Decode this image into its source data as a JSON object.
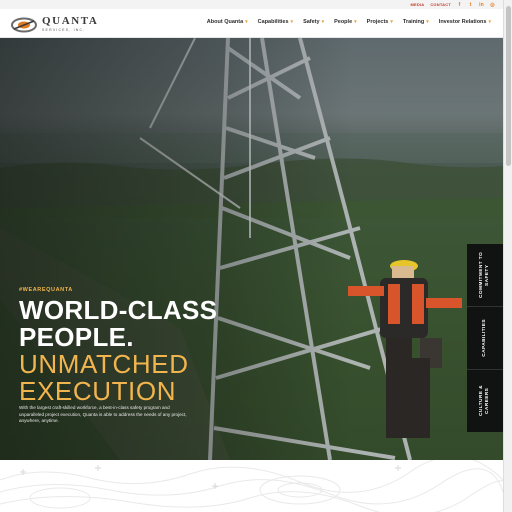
{
  "topbar": {
    "media_label": "MEDIA",
    "contact_label": "CONTACT",
    "social": [
      "facebook-icon",
      "twitter-icon",
      "linkedin-icon",
      "instagram-icon"
    ]
  },
  "header": {
    "logo_name": "QUANTA",
    "logo_sub": "SERVICES, INC.",
    "nav": [
      {
        "label": "About Quanta"
      },
      {
        "label": "Capabilities"
      },
      {
        "label": "Safety"
      },
      {
        "label": "People"
      },
      {
        "label": "Projects"
      },
      {
        "label": "Training"
      },
      {
        "label": "Investor Relations"
      }
    ]
  },
  "hero": {
    "hashtag": "#WEAREQUANTA",
    "line1": "WORLD-CLASS",
    "line2": "PEOPLE.",
    "line3": "UNMATCHED",
    "line4": "EXECUTION",
    "lede": "With the largest craft-skilled workforce, a best-in-class safety program and unparalleled project execution, Quanta is able to address the needs of any project, anywhere, anytime."
  },
  "side_tabs": [
    {
      "label": "COMMITMENT TO SAFETY"
    },
    {
      "label": "CAPABILITIES"
    },
    {
      "label": "CULTURE & CAREERS"
    }
  ],
  "colors": {
    "accent": "#f2b54e",
    "nav_caret": "#e8a33d",
    "utility_link": "#c0392b",
    "side_tab_bg": "#111313"
  }
}
